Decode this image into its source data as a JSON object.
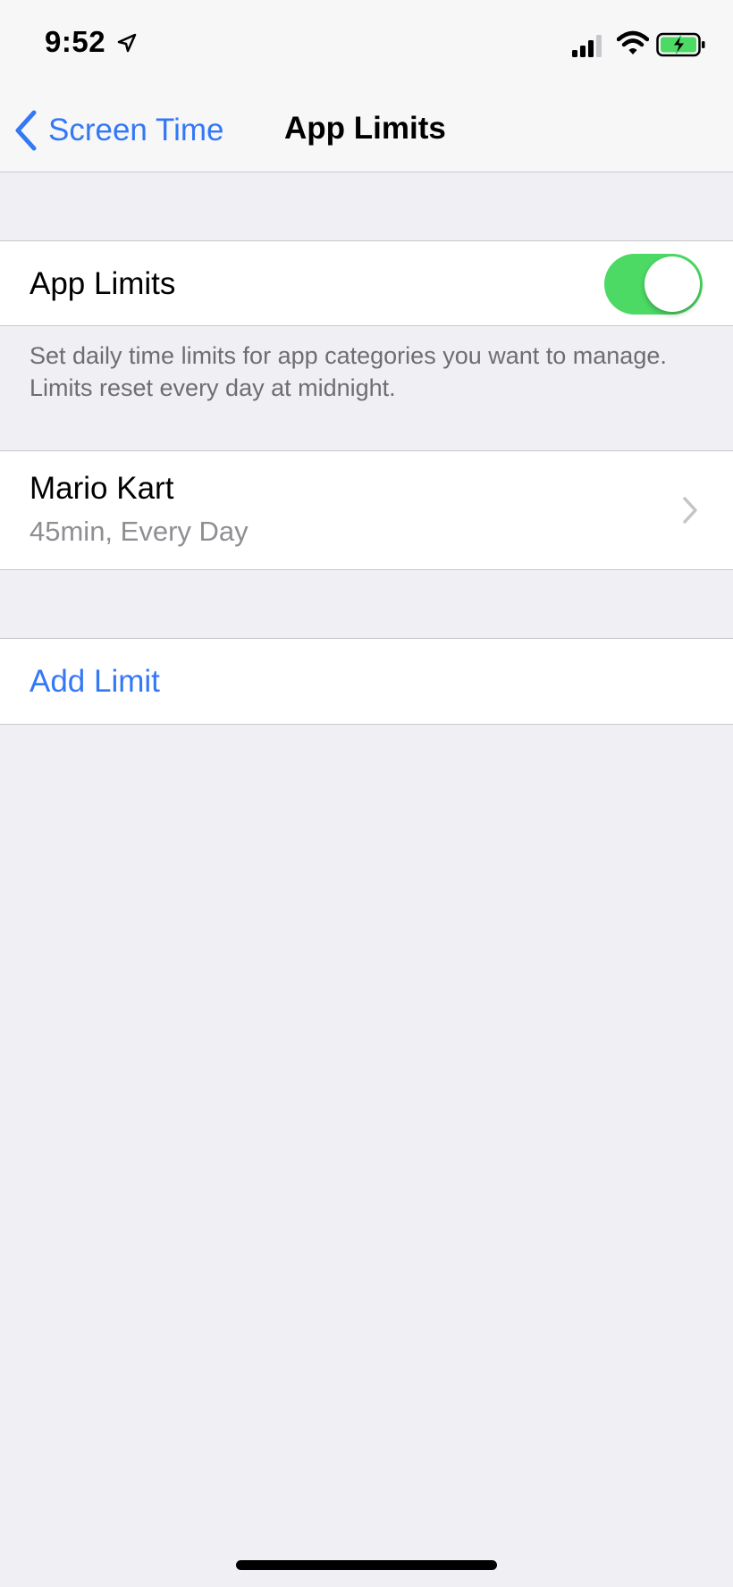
{
  "status_bar": {
    "time": "9:52",
    "icons": [
      "location-arrow-icon",
      "cellular-signal-icon",
      "wifi-icon",
      "battery-charging-icon"
    ]
  },
  "nav": {
    "back_label": "Screen Time",
    "back_icon": "chevron-left-icon",
    "title": "App Limits"
  },
  "app_limits_toggle": {
    "label": "App Limits",
    "enabled": true
  },
  "description": "Set daily time limits for app categories you want to manage. Limits reset every day at midnight.",
  "limits": [
    {
      "name": "Mario Kart",
      "detail": "45min, Every Day",
      "icon": "chevron-right-icon"
    }
  ],
  "add_limit_label": "Add Limit",
  "colors": {
    "accent": "#3478f6",
    "toggle_on": "#4cd964",
    "background": "#efeff4",
    "secondary_text": "#8e8e93"
  }
}
